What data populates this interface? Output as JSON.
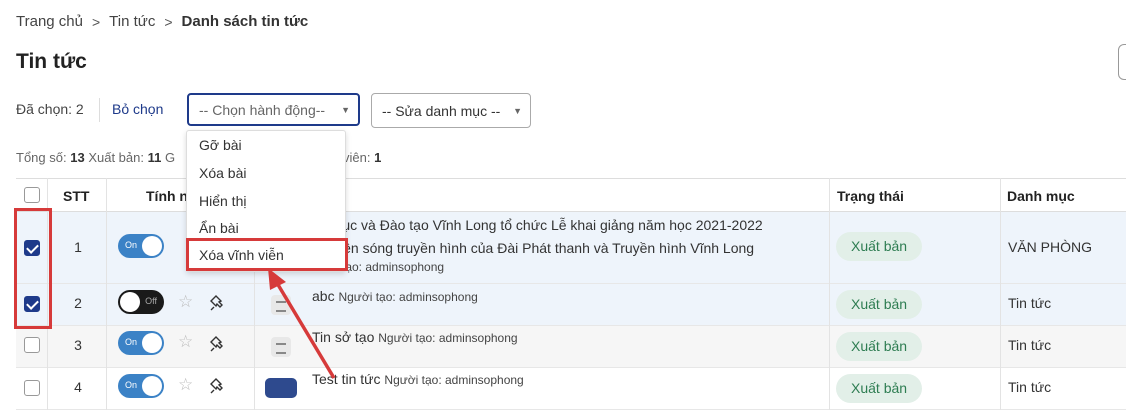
{
  "breadcrumb": {
    "home": "Trang chủ",
    "news": "Tin tức",
    "current": "Danh sách tin tức",
    "separator": ">"
  },
  "page_title": "Tin tức",
  "toolbar": {
    "selected_label": "Đã chọn: 2",
    "clear_label": "Bỏ chọn",
    "action_select_placeholder": "-- Chọn hành động--",
    "category_select_placeholder": "-- Sửa danh mục --"
  },
  "summary": {
    "total_label": "Tổng số:",
    "total": "13",
    "published_label": "Xuất bản:",
    "published": "11",
    "fragment": "G",
    "tail_label": "viên:",
    "tail_value": "1"
  },
  "dropdown": {
    "items": [
      "Gỡ bài",
      "Xóa bài",
      "Hiển thị",
      "Ẩn bài",
      "Xóa vĩnh viễn"
    ],
    "highlighted": "Xóa vĩnh viễn"
  },
  "table": {
    "headers": {
      "stt": "STT",
      "properties": "Tính n",
      "status": "Trạng thái",
      "category": "Danh mục"
    },
    "rows": [
      {
        "stt": "1",
        "checked": true,
        "toggle": "On",
        "title_line1": "iáo dục và Đào tạo Vĩnh Long tổ chức Lễ khai giảng năm học 2021-2022",
        "title_line2": "iếp trên sóng truyền hình của Đài Phát thanh và Truyền hình Vĩnh Long",
        "creator": "tạo: adminsophong",
        "status": "Xuất bản",
        "category": "VĂN PHÒNG"
      },
      {
        "stt": "2",
        "checked": true,
        "toggle": "Off",
        "title": "abc",
        "creator": "Người tạo: adminsophong",
        "status": "Xuất bản",
        "category": "Tin tức"
      },
      {
        "stt": "3",
        "checked": false,
        "toggle": "On",
        "title": "Tin sở tạo",
        "creator": "Người tạo: adminsophong",
        "status": "Xuất bản",
        "category": "Tin tức"
      },
      {
        "stt": "4",
        "checked": false,
        "toggle": "On",
        "title": "Test tin tức",
        "creator": "Người tạo: adminsophong",
        "status": "Xuất bản",
        "category": "Tin tức"
      }
    ]
  },
  "colors": {
    "accent": "#1e3a8a",
    "highlight": "#d63a3a",
    "badge_bg": "#e2efe8",
    "badge_text": "#2e7d52",
    "toggle_on": "#3b82c6"
  },
  "icons": [
    "chevron-right-icon",
    "caret-down-icon",
    "star-icon",
    "pin-icon",
    "document-icon",
    "arrow-annotation"
  ]
}
